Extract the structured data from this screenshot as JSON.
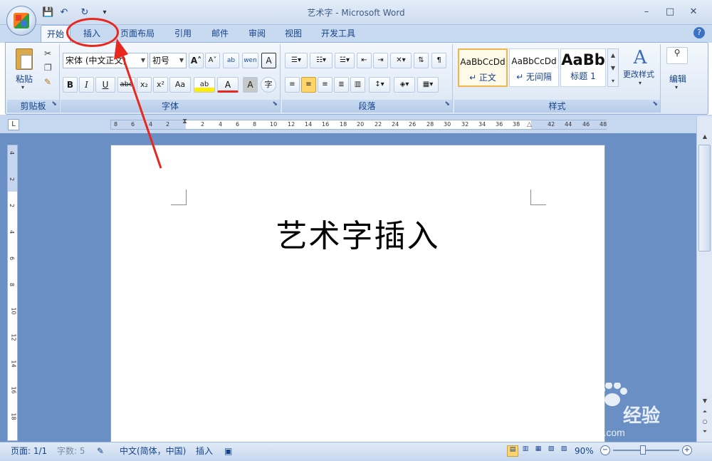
{
  "window": {
    "title": "艺术字 - Microsoft Word",
    "minimize": "–",
    "maximize": "□",
    "close": "✕"
  },
  "qat": {
    "save": "💾",
    "undo": "↶",
    "redo": "↻",
    "customize": "▾"
  },
  "tabs": [
    {
      "label": "开始",
      "active": true
    },
    {
      "label": "插入",
      "active": false
    },
    {
      "label": "页面布局",
      "active": false
    },
    {
      "label": "引用",
      "active": false
    },
    {
      "label": "邮件",
      "active": false
    },
    {
      "label": "审阅",
      "active": false
    },
    {
      "label": "视图",
      "active": false
    },
    {
      "label": "开发工具",
      "active": false
    }
  ],
  "help_icon": "?",
  "groups": {
    "clipboard": {
      "label": "剪贴板",
      "paste": "粘贴"
    },
    "font": {
      "label": "字体",
      "font_name": "宋体 (中文正文)",
      "font_size": "初号",
      "grow": "A˄",
      "shrink": "A˅",
      "bold": "B",
      "italic": "I",
      "underline": "U",
      "strike": "abc",
      "subscript": "x₂",
      "superscript": "x²",
      "change_case": "Aa",
      "highlight": "ab",
      "font_color": "A",
      "char_shading": "A",
      "enclose": "字",
      "phonetic": "ab",
      "char_border": "A",
      "clear_format": "wen"
    },
    "paragraph": {
      "label": "段落"
    },
    "styles": {
      "label": "样式",
      "items": [
        {
          "preview": "AaBbCcDd",
          "name": "↵ 正文"
        },
        {
          "preview": "AaBbCcDd",
          "name": "↵ 无间隔"
        },
        {
          "preview": "AaBb",
          "name": "标题 1"
        }
      ],
      "change_styles": "更改样式"
    },
    "editing": {
      "label": "编辑"
    }
  },
  "ruler": {
    "h_ticks": [
      "8",
      "6",
      "4",
      "2",
      "2",
      "4",
      "6",
      "8",
      "10",
      "12",
      "14",
      "16",
      "18",
      "20",
      "22",
      "24",
      "26",
      "28",
      "30",
      "32",
      "34",
      "36",
      "38",
      "42",
      "44",
      "46",
      "48"
    ],
    "v_ticks": [
      "4",
      "2",
      "2",
      "4",
      "6",
      "8",
      "10",
      "12",
      "14",
      "16",
      "18"
    ]
  },
  "document": {
    "text": "艺术字插入"
  },
  "status": {
    "page": "页面: 1/1",
    "words": "字数: 5",
    "language": "中文(简体，中国)",
    "mode": "插入",
    "zoom": "90%",
    "zoom_level": 0.45
  },
  "watermark": {
    "brand": "Baidu",
    "brand2": "经验",
    "url": "jingyan.baidu.com"
  },
  "colors": {
    "annotation": "#e8271f",
    "accent": "#15428b"
  }
}
